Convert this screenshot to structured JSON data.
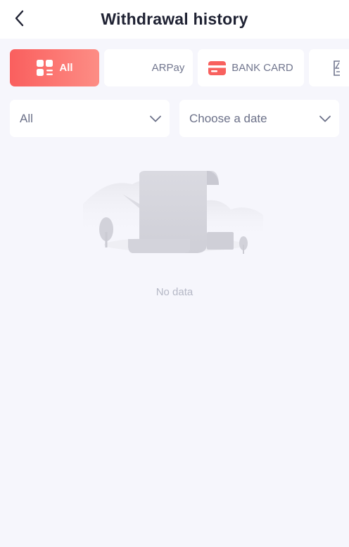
{
  "header": {
    "title": "Withdrawal history",
    "back_icon": "back-arrow-icon"
  },
  "tabs": [
    {
      "label": "All",
      "icon": "grid-list-icon",
      "active": true
    },
    {
      "label": "ARPay",
      "icon": "",
      "active": false
    },
    {
      "label": "BANK CARD",
      "icon": "bank-card-icon",
      "active": false
    }
  ],
  "filters": {
    "type": {
      "value": "All",
      "icon": "chevron-down-icon"
    },
    "date": {
      "value": "Choose a date",
      "icon": "chevron-down-icon"
    }
  },
  "empty_state": {
    "text": "No data",
    "icon": "empty-document-illustration"
  },
  "colors": {
    "accent": "#fa5f5e",
    "background": "#f6f6fc",
    "text_primary": "#1f2233",
    "text_secondary": "#6b7088"
  }
}
